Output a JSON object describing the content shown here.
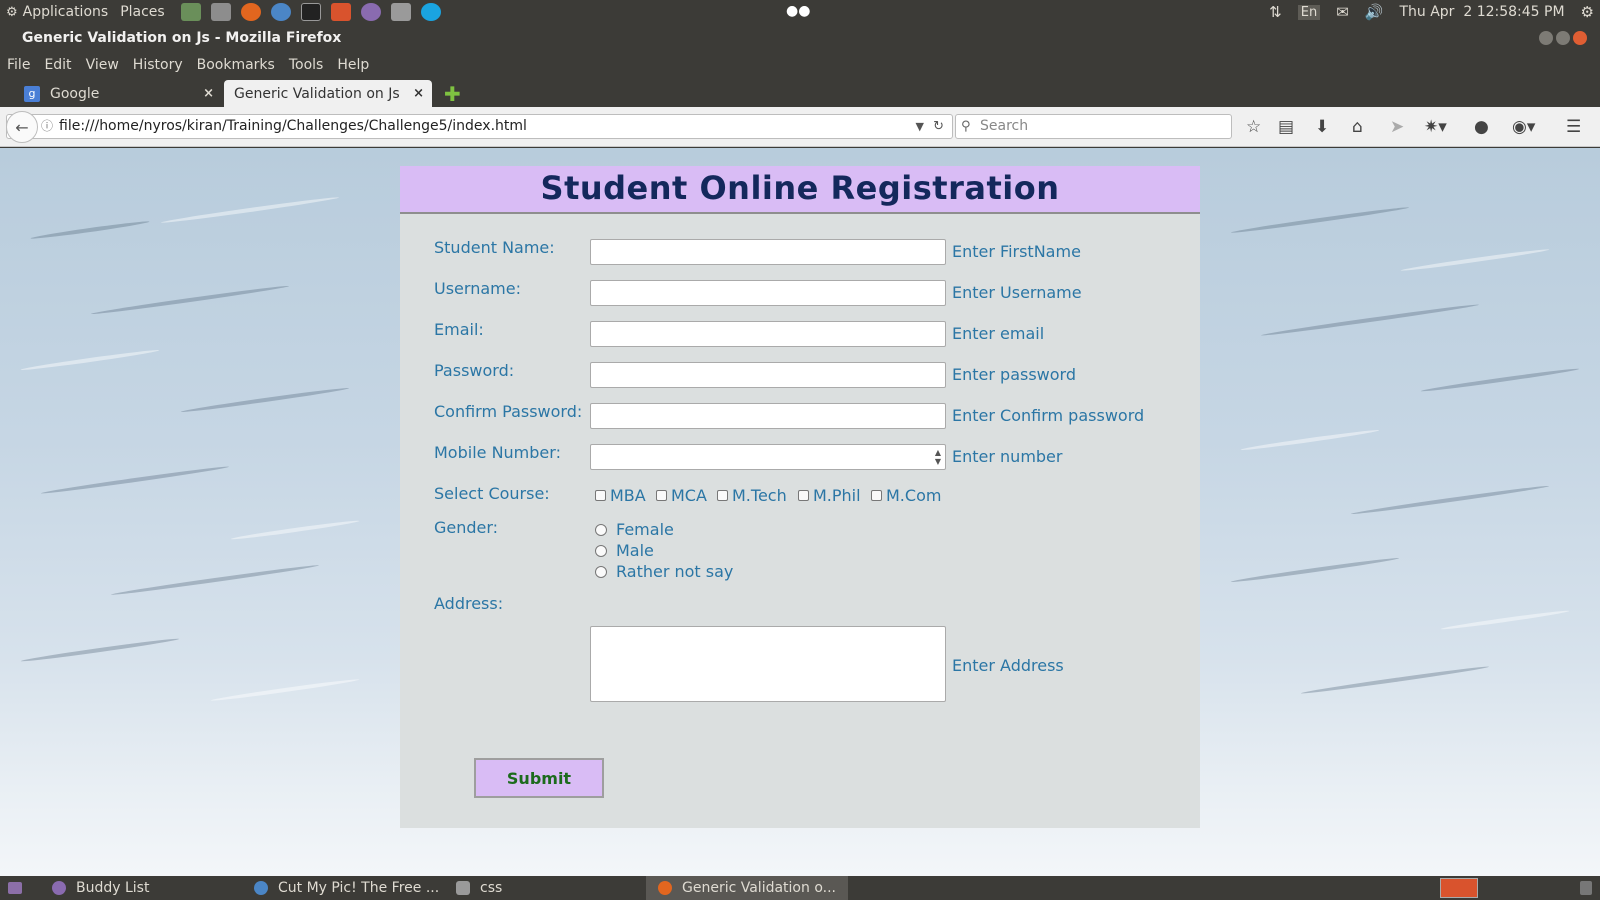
{
  "system": {
    "applications_label": "Applications",
    "places_label": "Places",
    "keyboard_layout": "En",
    "clock": "Thu Apr  2 12:58:45 PM"
  },
  "window": {
    "title": "Generic Validation on Js - Mozilla Firefox"
  },
  "menu": {
    "items": [
      "File",
      "Edit",
      "View",
      "History",
      "Bookmarks",
      "Tools",
      "Help"
    ]
  },
  "tabs": [
    {
      "label": "Google",
      "close": "×"
    },
    {
      "label": "Generic Validation on Js",
      "close": "×"
    }
  ],
  "browser": {
    "url": "file:///home/nyros/kiran/Training/Challenges/Challenge5/index.html",
    "search_placeholder": "Search"
  },
  "form": {
    "title": "Student Online Registration",
    "fields": [
      {
        "label": "Student Name:",
        "hint": "Enter FirstName"
      },
      {
        "label": "Username:",
        "hint": "Enter Username"
      },
      {
        "label": "Email:",
        "hint": "Enter email"
      },
      {
        "label": "Password:",
        "hint": "Enter password"
      },
      {
        "label": "Confirm Password:",
        "hint": "Enter Confirm password"
      },
      {
        "label": "Mobile Number:",
        "hint": "Enter number"
      }
    ],
    "course": {
      "label": "Select Course:",
      "options": [
        "MBA",
        "MCA",
        "M.Tech",
        "M.Phil",
        "M.Com"
      ]
    },
    "gender": {
      "label": "Gender:",
      "options": [
        "Female",
        "Male",
        "Rather not say"
      ]
    },
    "address": {
      "label": "Address:",
      "hint": "Enter Address"
    },
    "submit_label": "Submit"
  },
  "taskbar": {
    "items": [
      "Buddy List",
      "Cut My Pic! The Free ...",
      "css",
      "Generic Validation o..."
    ]
  },
  "colors": {
    "panel": "#3c3b37",
    "form_header": "#d9bcf5",
    "form_body": "#dbdfdf",
    "title_text": "#14285c",
    "label_text": "#2b76a5",
    "submit_text": "#1c6b1c"
  }
}
